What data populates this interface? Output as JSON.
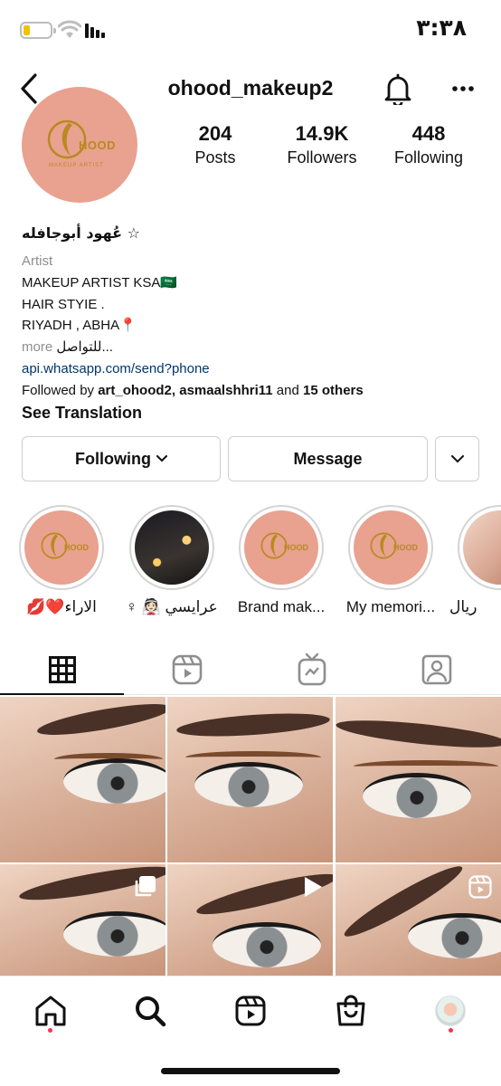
{
  "status_bar": {
    "time": "٣:٣٨"
  },
  "header": {
    "username": "ohood_makeup2"
  },
  "profile": {
    "logo_text": "HOOD",
    "logo_sub": "MAKEUP ARTIST",
    "stats": [
      {
        "value": "204",
        "label": "Posts"
      },
      {
        "value": "14.9K",
        "label": "Followers"
      },
      {
        "value": "448",
        "label": "Following"
      }
    ]
  },
  "bio": {
    "name": "عُهود أبوجافله ☆",
    "category": "Artist",
    "lines": [
      "MAKEUP ARTIST KSA🇸🇦",
      "HAIR STYIE .",
      "RIYADH , ABHA📍"
    ],
    "more_text": "للتواصل...",
    "more_label": "more",
    "link": "api.whatsapp.com/send?phone",
    "followed_by_prefix": "Followed by ",
    "followed_by_names": "art_ohood2, asmaalshhri11",
    "followed_by_and": " and ",
    "followed_by_others": "15 others",
    "see_translation": "See Translation"
  },
  "buttons": {
    "following": "Following",
    "message": "Message"
  },
  "highlights": [
    {
      "label": "💋❤️الاراء",
      "kind": "logo"
    },
    {
      "label": "♀ 👰🏻 عرايسي",
      "kind": "night"
    },
    {
      "label": "Brand mak...",
      "kind": "logo"
    },
    {
      "label": "My memori...",
      "kind": "logo"
    },
    {
      "label": "ريال",
      "kind": "face"
    }
  ],
  "tabs": [
    "grid-icon",
    "reels-icon",
    "igtv-icon",
    "tagged-icon"
  ],
  "bottom_nav": [
    "home-icon",
    "search-icon",
    "reels-icon",
    "shop-icon",
    "profile-avatar"
  ]
}
